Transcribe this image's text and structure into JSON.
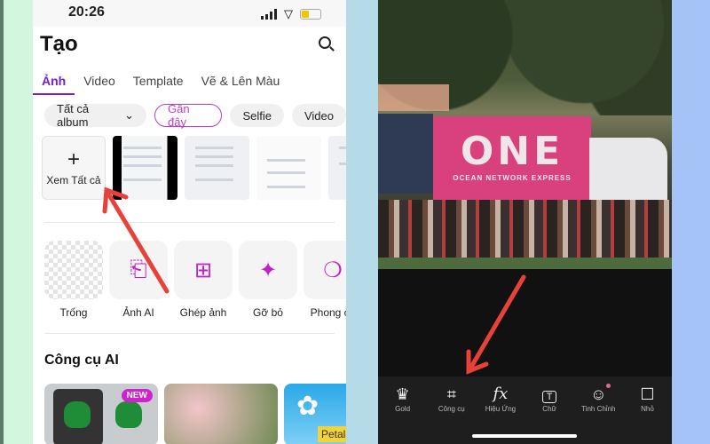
{
  "left_screen": {
    "status": {
      "time": "20:26"
    },
    "title": "Tạo",
    "tabs": [
      {
        "label": "Ảnh",
        "active": true
      },
      {
        "label": "Video"
      },
      {
        "label": "Template"
      },
      {
        "label": "Vẽ & Lên Màu"
      }
    ],
    "chips": [
      {
        "label": "Tất cả album"
      },
      {
        "label": "Gần đây",
        "selected": true
      },
      {
        "label": "Selfie"
      },
      {
        "label": "Video"
      }
    ],
    "see_all": "Xem Tất cả",
    "tools": [
      {
        "label": "Trống",
        "icon": "transparent-canvas-icon"
      },
      {
        "label": "Ảnh AI",
        "icon": "text-to-image-icon"
      },
      {
        "label": "Ghép ảnh",
        "icon": "collage-icon"
      },
      {
        "label": "Gỡ bỏ",
        "icon": "eraser-icon"
      },
      {
        "label": "Phong cá",
        "icon": "style-icon"
      }
    ],
    "section_title": "Công cụ AI",
    "new_badge": "NEW",
    "card3_text": "Petals"
  },
  "right_screen": {
    "photo_text": {
      "brand": "ONE",
      "sub": "OCEAN NETWORK EXPRESS"
    },
    "toolbar": [
      {
        "label": "Gold",
        "icon": "crown-icon"
      },
      {
        "label": "Công cụ",
        "icon": "crop-icon"
      },
      {
        "label": "Hiệu Ứng",
        "icon": "fx-icon"
      },
      {
        "label": "Chữ",
        "icon": "text-icon"
      },
      {
        "label": "Tinh Chỉnh",
        "icon": "retouch-icon"
      },
      {
        "label": "Nhỏ",
        "icon": "sticker-icon"
      }
    ]
  },
  "colors": {
    "accent": "#7a1fc7",
    "highlight": "#c03cc9",
    "arrow": "#e8413a"
  }
}
